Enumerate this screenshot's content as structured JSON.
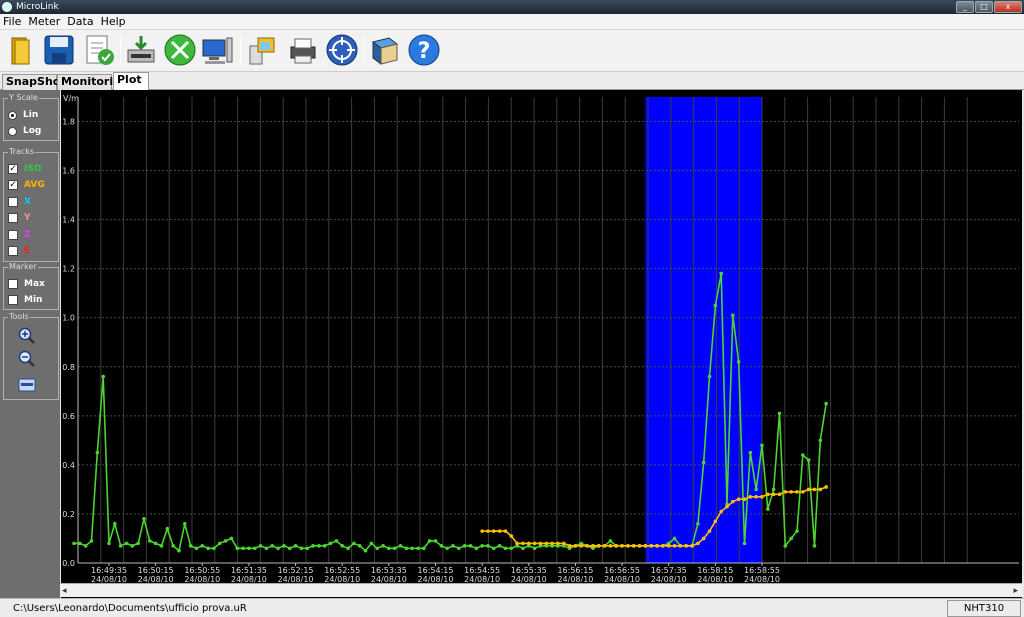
{
  "app": {
    "title": "MicroLink"
  },
  "window_controls": {
    "minimize": "_",
    "maximize": "□",
    "close": "x"
  },
  "menu": [
    "File",
    "Meter",
    "Data",
    "Help"
  ],
  "toolbar": [
    "open-folder-icon",
    "save-disk-icon",
    "checklist-icon",
    "download-device-icon",
    "tools-icon",
    "computer-icon",
    "device-folder-icon",
    "printer-icon",
    "target-icon",
    "book-icon",
    "help-icon"
  ],
  "tabs": [
    {
      "label": "SnapShots",
      "active": false
    },
    {
      "label": "Monitoring",
      "active": false
    },
    {
      "label": "Plot",
      "active": true
    }
  ],
  "side": {
    "yscale": {
      "label": "Y Scale",
      "options": [
        "Lin",
        "Log"
      ],
      "selected": "Lin"
    },
    "tracks": {
      "label": "Tracks",
      "items": [
        {
          "label": "ISO",
          "checked": true,
          "color": "#2ecc40"
        },
        {
          "label": "AVG",
          "checked": true,
          "color": "#ffb300"
        },
        {
          "label": "X",
          "checked": false,
          "color": "#00c8ff"
        },
        {
          "label": "Y",
          "checked": false,
          "color": "#ff9090"
        },
        {
          "label": "Z",
          "checked": false,
          "color": "#e040fb"
        },
        {
          "label": "E",
          "checked": false,
          "color": "#ff2020"
        }
      ]
    },
    "marker": {
      "label": "Marker",
      "items": [
        {
          "label": "Max",
          "checked": false
        },
        {
          "label": "Min",
          "checked": false
        }
      ]
    },
    "tools": {
      "label": "Tools",
      "items": [
        "zoom-in-icon",
        "zoom-out-icon",
        "fit-view-icon"
      ]
    }
  },
  "chart_data": {
    "type": "line",
    "ylabel": "V/m",
    "ylim": [
      0,
      1.9
    ],
    "yticks": [
      "0.0",
      "0.2",
      "0.4",
      "0.6",
      "0.8",
      "1.0",
      "1.2",
      "1.4",
      "1.6",
      "1.8"
    ],
    "xticks": [
      {
        "time": "16:49:35",
        "date": "24/08/10"
      },
      {
        "time": "16:50:15",
        "date": "24/08/10"
      },
      {
        "time": "16:50:55",
        "date": "24/08/10"
      },
      {
        "time": "16:51:35",
        "date": "24/08/10"
      },
      {
        "time": "16:52:15",
        "date": "24/08/10"
      },
      {
        "time": "16:52:55",
        "date": "24/08/10"
      },
      {
        "time": "16:53:35",
        "date": "24/08/10"
      },
      {
        "time": "16:54:15",
        "date": "24/08/10"
      },
      {
        "time": "16:54:55",
        "date": "24/08/10"
      },
      {
        "time": "16:55:35",
        "date": "24/08/10"
      },
      {
        "time": "16:56:15",
        "date": "24/08/10"
      },
      {
        "time": "16:56:55",
        "date": "24/08/10"
      },
      {
        "time": "16:57:35",
        "date": "24/08/10"
      },
      {
        "time": "16:58:15",
        "date": "24/08/10"
      },
      {
        "time": "16:58:55",
        "date": "24/08/10"
      }
    ],
    "grid": true,
    "highlight": {
      "from": "16:57:15",
      "to": "16:58:55",
      "color": "#0000ff"
    },
    "series": [
      {
        "name": "ISO",
        "color": "#4cd430",
        "values": [
          [
            "16:49:05",
            0.08
          ],
          [
            "16:49:10",
            0.08
          ],
          [
            "16:49:15",
            0.07
          ],
          [
            "16:49:20",
            0.09
          ],
          [
            "16:49:25",
            0.45
          ],
          [
            "16:49:30",
            0.76
          ],
          [
            "16:49:35",
            0.08
          ],
          [
            "16:49:40",
            0.16
          ],
          [
            "16:49:45",
            0.07
          ],
          [
            "16:49:50",
            0.08
          ],
          [
            "16:49:55",
            0.07
          ],
          [
            "16:50:00",
            0.08
          ],
          [
            "16:50:05",
            0.18
          ],
          [
            "16:50:10",
            0.09
          ],
          [
            "16:50:15",
            0.08
          ],
          [
            "16:50:20",
            0.07
          ],
          [
            "16:50:25",
            0.14
          ],
          [
            "16:50:30",
            0.07
          ],
          [
            "16:50:35",
            0.05
          ],
          [
            "16:50:40",
            0.16
          ],
          [
            "16:50:45",
            0.07
          ],
          [
            "16:50:50",
            0.06
          ],
          [
            "16:50:55",
            0.07
          ],
          [
            "16:51:00",
            0.06
          ],
          [
            "16:51:05",
            0.06
          ],
          [
            "16:51:10",
            0.08
          ],
          [
            "16:51:15",
            0.09
          ],
          [
            "16:51:20",
            0.1
          ],
          [
            "16:51:25",
            0.06
          ],
          [
            "16:51:30",
            0.06
          ],
          [
            "16:51:35",
            0.06
          ],
          [
            "16:51:40",
            0.06
          ],
          [
            "16:51:45",
            0.07
          ],
          [
            "16:51:50",
            0.06
          ],
          [
            "16:51:55",
            0.07
          ],
          [
            "16:52:00",
            0.06
          ],
          [
            "16:52:05",
            0.07
          ],
          [
            "16:52:10",
            0.06
          ],
          [
            "16:52:15",
            0.07
          ],
          [
            "16:52:20",
            0.06
          ],
          [
            "16:52:25",
            0.06
          ],
          [
            "16:52:30",
            0.07
          ],
          [
            "16:52:35",
            0.07
          ],
          [
            "16:52:40",
            0.07
          ],
          [
            "16:52:45",
            0.08
          ],
          [
            "16:52:50",
            0.09
          ],
          [
            "16:52:55",
            0.07
          ],
          [
            "16:53:00",
            0.06
          ],
          [
            "16:53:05",
            0.08
          ],
          [
            "16:53:10",
            0.07
          ],
          [
            "16:53:15",
            0.05
          ],
          [
            "16:53:20",
            0.08
          ],
          [
            "16:53:25",
            0.06
          ],
          [
            "16:53:30",
            0.07
          ],
          [
            "16:53:35",
            0.06
          ],
          [
            "16:53:40",
            0.06
          ],
          [
            "16:53:45",
            0.07
          ],
          [
            "16:53:50",
            0.06
          ],
          [
            "16:53:55",
            0.06
          ],
          [
            "16:54:00",
            0.06
          ],
          [
            "16:54:05",
            0.06
          ],
          [
            "16:54:10",
            0.09
          ],
          [
            "16:54:15",
            0.09
          ],
          [
            "16:54:20",
            0.07
          ],
          [
            "16:54:25",
            0.06
          ],
          [
            "16:54:30",
            0.07
          ],
          [
            "16:54:35",
            0.06
          ],
          [
            "16:54:40",
            0.07
          ],
          [
            "16:54:45",
            0.07
          ],
          [
            "16:54:50",
            0.06
          ],
          [
            "16:54:55",
            0.07
          ],
          [
            "16:55:00",
            0.07
          ],
          [
            "16:55:05",
            0.06
          ],
          [
            "16:55:10",
            0.07
          ],
          [
            "16:55:15",
            0.06
          ],
          [
            "16:55:20",
            0.06
          ],
          [
            "16:55:25",
            0.07
          ],
          [
            "16:55:30",
            0.06
          ],
          [
            "16:55:35",
            0.07
          ],
          [
            "16:55:40",
            0.06
          ],
          [
            "16:55:45",
            0.07
          ],
          [
            "16:55:50",
            0.07
          ],
          [
            "16:55:55",
            0.07
          ],
          [
            "16:56:00",
            0.07
          ],
          [
            "16:56:05",
            0.07
          ],
          [
            "16:56:10",
            0.06
          ],
          [
            "16:56:15",
            0.07
          ],
          [
            "16:56:20",
            0.08
          ],
          [
            "16:56:25",
            0.07
          ],
          [
            "16:56:30",
            0.06
          ],
          [
            "16:56:35",
            0.07
          ],
          [
            "16:56:40",
            0.07
          ],
          [
            "16:56:45",
            0.09
          ],
          [
            "16:56:50",
            0.07
          ],
          [
            "16:56:55",
            0.07
          ],
          [
            "16:57:00",
            0.07
          ],
          [
            "16:57:05",
            0.07
          ],
          [
            "16:57:10",
            0.07
          ],
          [
            "16:57:15",
            0.07
          ],
          [
            "16:57:20",
            0.07
          ],
          [
            "16:57:25",
            0.07
          ],
          [
            "16:57:30",
            0.07
          ],
          [
            "16:57:35",
            0.08
          ],
          [
            "16:57:40",
            0.1
          ],
          [
            "16:57:45",
            0.07
          ],
          [
            "16:57:50",
            0.07
          ],
          [
            "16:57:55",
            0.07
          ],
          [
            "16:58:00",
            0.16
          ],
          [
            "16:58:05",
            0.41
          ],
          [
            "16:58:10",
            0.76
          ],
          [
            "16:58:15",
            1.05
          ],
          [
            "16:58:20",
            1.18
          ],
          [
            "16:58:25",
            0.24
          ],
          [
            "16:58:30",
            1.01
          ],
          [
            "16:58:35",
            0.82
          ],
          [
            "16:58:40",
            0.08
          ],
          [
            "16:58:45",
            0.45
          ],
          [
            "16:58:50",
            0.3
          ],
          [
            "16:58:55",
            0.48
          ],
          [
            "16:59:00",
            0.22
          ],
          [
            "16:59:05",
            0.3
          ],
          [
            "16:59:10",
            0.61
          ],
          [
            "16:59:15",
            0.07
          ],
          [
            "16:59:20",
            0.1
          ],
          [
            "16:59:25",
            0.13
          ],
          [
            "16:59:30",
            0.44
          ],
          [
            "16:59:35",
            0.42
          ],
          [
            "16:59:40",
            0.07
          ],
          [
            "16:59:45",
            0.5
          ],
          [
            "16:59:50",
            0.65
          ]
        ]
      },
      {
        "name": "AVG",
        "color": "#ffc000",
        "values": [
          [
            "16:54:55",
            0.13
          ],
          [
            "16:55:00",
            0.13
          ],
          [
            "16:55:05",
            0.13
          ],
          [
            "16:55:10",
            0.13
          ],
          [
            "16:55:15",
            0.13
          ],
          [
            "16:55:20",
            0.11
          ],
          [
            "16:55:25",
            0.08
          ],
          [
            "16:55:30",
            0.08
          ],
          [
            "16:55:35",
            0.08
          ],
          [
            "16:55:40",
            0.08
          ],
          [
            "16:55:45",
            0.08
          ],
          [
            "16:55:50",
            0.08
          ],
          [
            "16:55:55",
            0.08
          ],
          [
            "16:56:00",
            0.08
          ],
          [
            "16:56:05",
            0.08
          ],
          [
            "16:56:10",
            0.07
          ],
          [
            "16:56:15",
            0.07
          ],
          [
            "16:56:20",
            0.07
          ],
          [
            "16:56:25",
            0.07
          ],
          [
            "16:56:30",
            0.07
          ],
          [
            "16:56:35",
            0.07
          ],
          [
            "16:56:40",
            0.07
          ],
          [
            "16:56:45",
            0.07
          ],
          [
            "16:56:50",
            0.07
          ],
          [
            "16:56:55",
            0.07
          ],
          [
            "16:57:00",
            0.07
          ],
          [
            "16:57:05",
            0.07
          ],
          [
            "16:57:10",
            0.07
          ],
          [
            "16:57:15",
            0.07
          ],
          [
            "16:57:20",
            0.07
          ],
          [
            "16:57:25",
            0.07
          ],
          [
            "16:57:30",
            0.07
          ],
          [
            "16:57:35",
            0.07
          ],
          [
            "16:57:40",
            0.07
          ],
          [
            "16:57:45",
            0.07
          ],
          [
            "16:57:50",
            0.07
          ],
          [
            "16:57:55",
            0.07
          ],
          [
            "16:58:00",
            0.08
          ],
          [
            "16:58:05",
            0.1
          ],
          [
            "16:58:10",
            0.13
          ],
          [
            "16:58:15",
            0.17
          ],
          [
            "16:58:20",
            0.21
          ],
          [
            "16:58:25",
            0.23
          ],
          [
            "16:58:30",
            0.25
          ],
          [
            "16:58:35",
            0.26
          ],
          [
            "16:58:40",
            0.26
          ],
          [
            "16:58:45",
            0.27
          ],
          [
            "16:58:50",
            0.27
          ],
          [
            "16:58:55",
            0.27
          ],
          [
            "16:59:00",
            0.28
          ],
          [
            "16:59:05",
            0.28
          ],
          [
            "16:59:10",
            0.28
          ],
          [
            "16:59:15",
            0.29
          ],
          [
            "16:59:20",
            0.29
          ],
          [
            "16:59:25",
            0.29
          ],
          [
            "16:59:30",
            0.29
          ],
          [
            "16:59:35",
            0.3
          ],
          [
            "16:59:40",
            0.3
          ],
          [
            "16:59:45",
            0.3
          ],
          [
            "16:59:50",
            0.31
          ]
        ]
      }
    ]
  },
  "status": {
    "path": "C:\\Users\\Leonardo\\Documents\\ufficio prova.uR",
    "device": "NHT310"
  }
}
